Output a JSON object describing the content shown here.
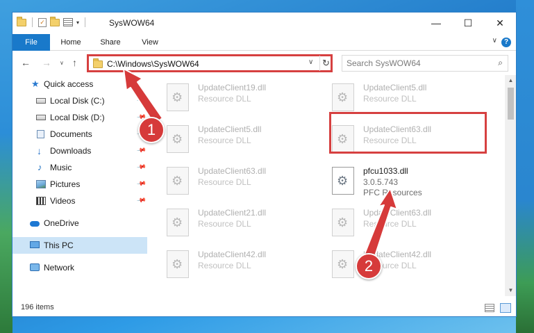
{
  "window": {
    "title": "SysWOW64",
    "controls": {
      "minimize": "—",
      "maximize": "☐",
      "close": "✕"
    }
  },
  "ribbon": {
    "tabs": [
      "File",
      "Home",
      "Share",
      "View"
    ],
    "expand": "∨",
    "help": "?"
  },
  "navbar": {
    "back": "←",
    "forward": "→",
    "recent": "∨",
    "up": "↑",
    "address": "C:\\Windows\\SysWOW64",
    "address_dropdown": "∨",
    "refresh": "↻",
    "search_placeholder": "Search SysWOW64",
    "search_icon": "⌕"
  },
  "sidebar": {
    "items": [
      {
        "label": "Quick access",
        "icon": "star-icon",
        "pinned": false
      },
      {
        "label": "Local Disk (C:)",
        "icon": "drive-icon",
        "pinned": true
      },
      {
        "label": "Local Disk (D:)",
        "icon": "drive-icon",
        "pinned": true
      },
      {
        "label": "Documents",
        "icon": "documents-icon",
        "pinned": true
      },
      {
        "label": "Downloads",
        "icon": "download-icon",
        "pinned": true
      },
      {
        "label": "Music",
        "icon": "music-icon",
        "pinned": true
      },
      {
        "label": "Pictures",
        "icon": "pictures-icon",
        "pinned": true
      },
      {
        "label": "Videos",
        "icon": "videos-icon",
        "pinned": true
      },
      {
        "label": "OneDrive",
        "icon": "onedrive-icon",
        "pinned": false
      },
      {
        "label": "This PC",
        "icon": "computer-icon",
        "pinned": false,
        "selected": true
      },
      {
        "label": "Network",
        "icon": "network-icon",
        "pinned": false
      }
    ]
  },
  "files": [
    {
      "name": "UpdateClient19.dll",
      "type": "Resource DLL"
    },
    {
      "name": "UpdateClient5.dll",
      "type": "Resource DLL"
    },
    {
      "name": "UpdateClient5.dll",
      "type": "Resource DLL"
    },
    {
      "name": "UpdateClient63.dll",
      "type": "Resource DLL"
    },
    {
      "name": "UpdateClient63.dll",
      "type": "Resource DLL"
    },
    {
      "name": "pfcu1033.dll",
      "version": "3.0.5.743",
      "type": "PFC Resources",
      "highlighted": true
    },
    {
      "name": "UpdateClient21.dll",
      "type": "Resource DLL"
    },
    {
      "name": "UpdateClient63.dll",
      "type": "Resource DLL"
    },
    {
      "name": "UpdateClient42.dll",
      "type": "Resource DLL"
    },
    {
      "name": "UpdateClient42.dll",
      "type": "Resource DLL"
    }
  ],
  "status": {
    "item_count": "196 items"
  },
  "annotations": {
    "step1": "1",
    "step2": "2"
  },
  "colors": {
    "accent": "#1979ca",
    "annotation": "#d63a3a",
    "selection": "#cce4f7"
  }
}
